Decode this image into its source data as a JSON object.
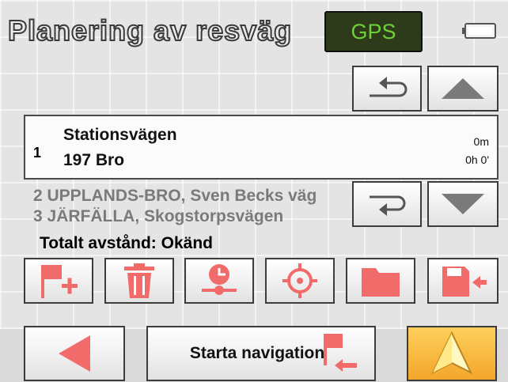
{
  "header": {
    "title": "Planering av resväg",
    "gps_label": "GPS"
  },
  "route": {
    "current": {
      "index": "1",
      "street": "Stationsvägen",
      "city": "197 Bro",
      "distance": "0m",
      "time": "0h 0'"
    },
    "stops": [
      {
        "text": "2 UPPLANDS-BRO, Sven Becks väg"
      },
      {
        "text": "3 JÄRFÄLLA, Skogstorpsvägen"
      }
    ],
    "total_label": "Totalt avstånd: Okänd"
  },
  "toolbar": {
    "icons": [
      "add-stop-icon",
      "delete-icon",
      "route-options-icon",
      "current-position-icon",
      "load-route-icon",
      "save-route-icon"
    ]
  },
  "footer": {
    "start_label": "Starta navigation"
  },
  "colors": {
    "accent_red": "#f26b6b",
    "gps_green": "#6fd13a",
    "nav_yellow": "#f5b23a"
  }
}
